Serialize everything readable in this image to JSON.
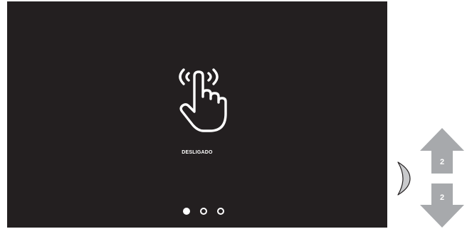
{
  "screen": {
    "background_color": "#231f20",
    "icon": "touch-hand-icon",
    "status_label": "DESLIGADO"
  },
  "pager": {
    "pages": 3,
    "active_index": 0,
    "dot_color": "#ffffff"
  },
  "side_controls": {
    "handle_icon": "side-handle-icon",
    "arrow_color": "#a7a9ac",
    "up_arrow": {
      "icon": "arrow-up-icon",
      "label": "2"
    },
    "down_arrow": {
      "icon": "arrow-down-icon",
      "label": "2"
    }
  }
}
